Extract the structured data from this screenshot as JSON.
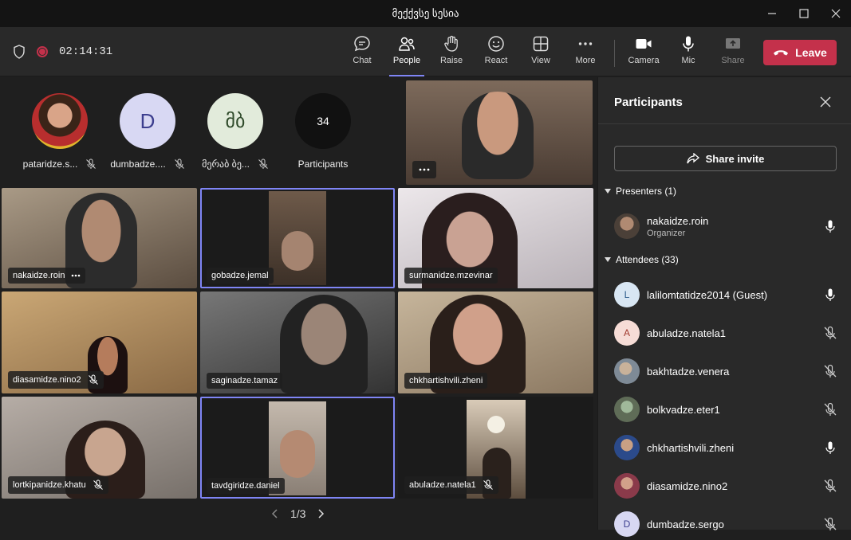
{
  "window": {
    "title": "მექქვსე სესია"
  },
  "toolbar": {
    "timer": "02:14:31",
    "buttons": [
      {
        "label": "Chat",
        "icon": "chat-icon"
      },
      {
        "label": "People",
        "icon": "people-icon",
        "active": true
      },
      {
        "label": "Raise",
        "icon": "hand-icon"
      },
      {
        "label": "React",
        "icon": "smiley-icon"
      },
      {
        "label": "View",
        "icon": "grid-icon"
      },
      {
        "label": "More",
        "icon": "ellipsis-icon"
      },
      {
        "label": "Camera",
        "icon": "camera-icon"
      },
      {
        "label": "Mic",
        "icon": "microphone-icon"
      },
      {
        "label": "Share",
        "icon": "share-tray-icon"
      }
    ],
    "leave_label": "Leave"
  },
  "stage": {
    "avatars": [
      {
        "name": "pataridze.s...",
        "initials": "",
        "muted": true
      },
      {
        "name": "dumbadze....",
        "initials": "D",
        "muted": true
      },
      {
        "name": "მერაბ ბე...",
        "initials": "მბ",
        "muted": true
      },
      {
        "name": "Participants",
        "initials": "34",
        "muted": false
      }
    ],
    "tiles": [
      {
        "name": "nakaidze.roin",
        "muted": false,
        "more": true
      },
      {
        "name": "gobadze.jemal",
        "muted": false
      },
      {
        "name": "surmanidze.mzevinar",
        "muted": false
      },
      {
        "name": "diasamidze.nino2",
        "muted": true
      },
      {
        "name": "saginadze.tamaz",
        "muted": false
      },
      {
        "name": "chkhartishvili.zheni",
        "muted": false
      },
      {
        "name": "lortkipanidze.khatu",
        "muted": true
      },
      {
        "name": "tavdgiridze.daniel",
        "muted": false
      },
      {
        "name": "abuladze.natela1",
        "muted": true
      }
    ],
    "pager": "1/3"
  },
  "panel": {
    "title": "Participants",
    "share_invite": "Share invite",
    "presenters_heading": "Presenters (1)",
    "attendees_heading": "Attendees (33)",
    "presenters": [
      {
        "name": "nakaidze.roin",
        "role": "Organizer",
        "mic": "on"
      }
    ],
    "attendees": [
      {
        "name": "lalilomtatidze2014 (Guest)",
        "initials": "L",
        "mic": "on"
      },
      {
        "name": "abuladze.natela1",
        "initials": "A",
        "mic": "off"
      },
      {
        "name": "bakhtadze.venera",
        "initials": "",
        "mic": "off"
      },
      {
        "name": "bolkvadze.eter1",
        "initials": "",
        "mic": "off"
      },
      {
        "name": "chkhartishvili.zheni",
        "initials": "",
        "mic": "on"
      },
      {
        "name": "diasamidze.nino2",
        "initials": "",
        "mic": "off"
      },
      {
        "name": "dumbadze.sergo",
        "initials": "D",
        "mic": "off"
      }
    ]
  },
  "colors": {
    "accent": "#7f85f5",
    "leave": "#c4314b"
  }
}
